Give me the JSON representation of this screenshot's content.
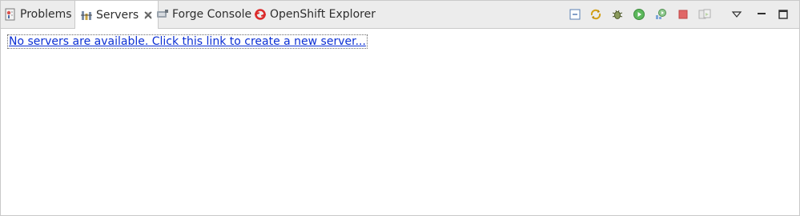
{
  "tabs": [
    {
      "label": "Problems",
      "icon": "problems-icon",
      "active": false
    },
    {
      "label": "Servers",
      "icon": "servers-icon",
      "active": true
    },
    {
      "label": "Forge Console",
      "icon": "forge-console-icon",
      "active": false
    },
    {
      "label": "OpenShift Explorer",
      "icon": "openshift-icon",
      "active": false
    }
  ],
  "toolbar": {
    "icons": [
      "collapse-all-icon",
      "link-with-editor-icon",
      "debug-server-icon",
      "start-server-icon",
      "profile-server-icon",
      "stop-server-icon",
      "publish-icon",
      "view-menu-icon",
      "minimize-icon",
      "maximize-icon"
    ]
  },
  "content": {
    "empty_link": "No servers are available. Click this link to create a new server..."
  },
  "colors": {
    "link": "#0b2fd4",
    "start_green": "#5cb85c",
    "stop_red": "#e06666",
    "openshift_red": "#db2b2b"
  }
}
